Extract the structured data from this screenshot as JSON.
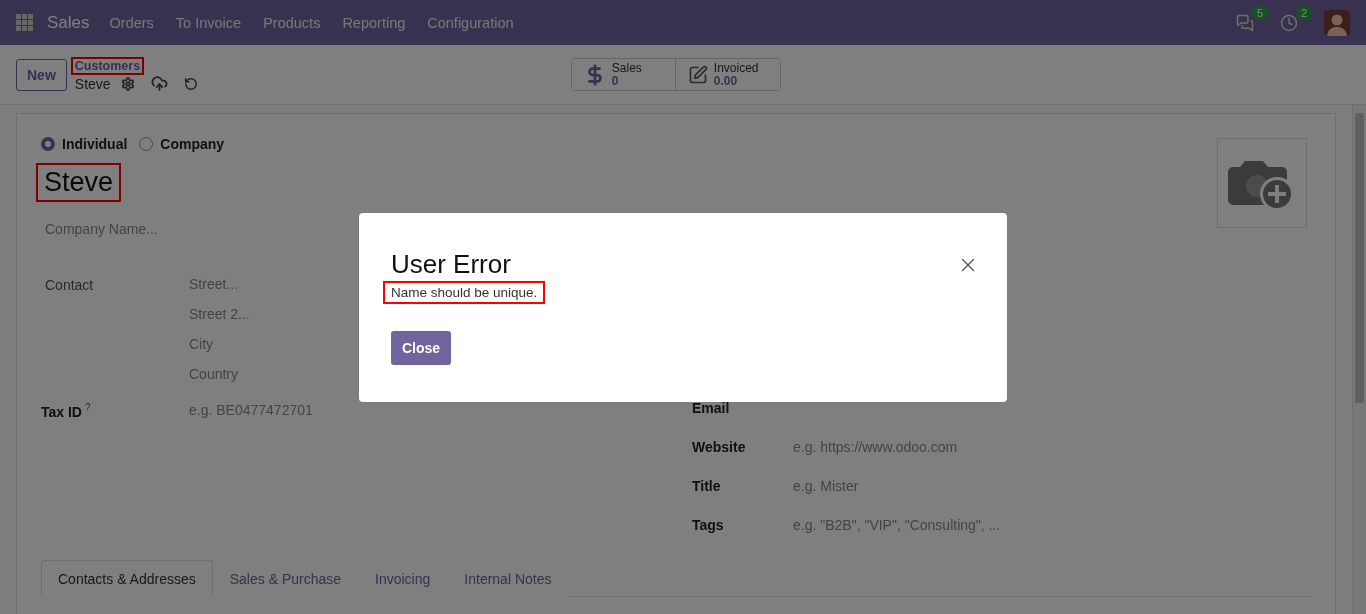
{
  "navbar": {
    "app": "Sales",
    "menu": [
      "Orders",
      "To Invoice",
      "Products",
      "Reporting",
      "Configuration"
    ],
    "badges": [
      {
        "kind": "messages",
        "count": "5"
      },
      {
        "kind": "activities",
        "count": "2"
      }
    ]
  },
  "control_panel": {
    "new_button": "New",
    "breadcrumb": {
      "parent": "Customers",
      "parent_highlighted": true,
      "current": "Steve"
    },
    "stat_buttons": [
      {
        "kind": "sales",
        "label": "Sales",
        "value": "0"
      },
      {
        "kind": "invoiced",
        "label": "Invoiced",
        "value": "0.00"
      }
    ]
  },
  "form": {
    "company_type": [
      {
        "label": "Individual",
        "selected": true
      },
      {
        "label": "Company",
        "selected": false
      }
    ],
    "name": "Steve",
    "name_highlighted": true,
    "company_name_placeholder": "Company Name...",
    "left_fields": [
      {
        "kind": "address",
        "label": "Contact",
        "placeholders": [
          "Street...",
          "Street 2...",
          "City",
          "Country"
        ]
      },
      {
        "kind": "field",
        "label": "Tax ID",
        "help": "?",
        "placeholders": [
          "e.g. BE0477472701"
        ]
      }
    ],
    "right_fields": [
      {
        "label": "Email"
      },
      {
        "label": "Website",
        "placeholder": "e.g. https://www.odoo.com"
      },
      {
        "label": "Title",
        "placeholder": "e.g. Mister"
      },
      {
        "label": "Tags",
        "placeholder": "e.g. \"B2B\", \"VIP\", \"Consulting\", ..."
      }
    ],
    "tabs": [
      {
        "label": "Contacts & Addresses",
        "selected": true
      },
      {
        "label": "Sales & Purchase",
        "selected": false
      },
      {
        "label": "Invoicing",
        "selected": false
      },
      {
        "label": "Internal Notes",
        "selected": false
      }
    ]
  },
  "dialog": {
    "title": "User Error",
    "message": "Name should be unique.",
    "message_highlighted": true,
    "button": "Close"
  }
}
